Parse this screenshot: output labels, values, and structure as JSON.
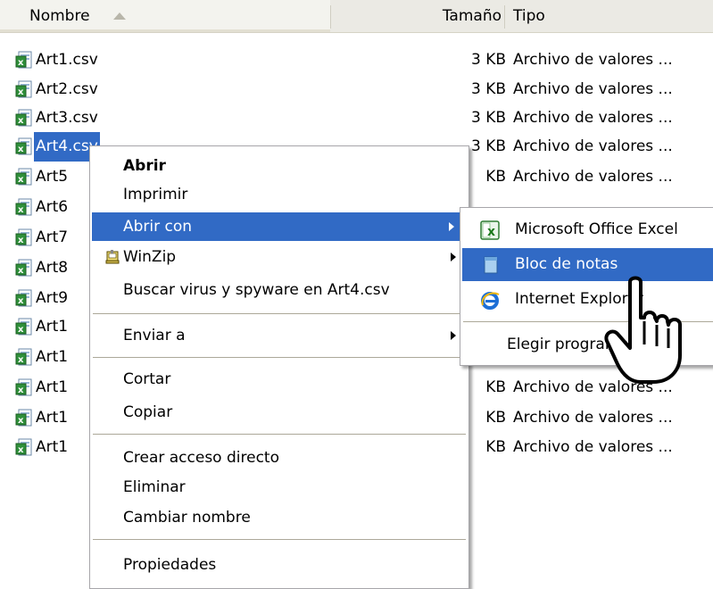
{
  "header": {
    "name": "Nombre",
    "size": "Tamaño",
    "type": "Tipo"
  },
  "files": [
    {
      "name": "Art1.csv",
      "size": "3 KB",
      "type": "Archivo de valores ..."
    },
    {
      "name": "Art2.csv",
      "size": "3 KB",
      "type": "Archivo de valores ..."
    },
    {
      "name": "Art3.csv",
      "size": "3 KB",
      "type": "Archivo de valores ..."
    },
    {
      "name": "Art4.csv",
      "size": "3 KB",
      "type": "Archivo de valores ..."
    },
    {
      "name": "Art5",
      "size": "KB",
      "type": "Archivo de valores ..."
    },
    {
      "name": "Art6",
      "size": "",
      "type": ""
    },
    {
      "name": "Art7",
      "size": "",
      "type": ""
    },
    {
      "name": "Art8",
      "size": "",
      "type": ""
    },
    {
      "name": "Art9",
      "size": "",
      "type": ""
    },
    {
      "name": "Art1",
      "size": "",
      "type": ""
    },
    {
      "name": "Art1",
      "size": "",
      "type": ""
    },
    {
      "name": "Art1",
      "size": "KB",
      "type": "Archivo de valores ..."
    },
    {
      "name": "Art1",
      "size": "KB",
      "type": "Archivo de valores ..."
    },
    {
      "name": "Art1",
      "size": "KB",
      "type": "Archivo de valores ..."
    }
  ],
  "context_menu": {
    "open": "Abrir",
    "print": "Imprimir",
    "open_with": "Abrir con",
    "winzip": "WinZip",
    "scan": "Buscar virus y spyware en Art4.csv",
    "send_to": "Enviar a",
    "cut": "Cortar",
    "copy": "Copiar",
    "create_shortcut": "Crear acceso directo",
    "delete": "Eliminar",
    "rename": "Cambiar nombre",
    "properties": "Propiedades"
  },
  "open_with_menu": {
    "excel": "Microsoft Office Excel",
    "notepad": "Bloc de notas",
    "ie": "Internet Explorer",
    "choose": "Elegir programa..."
  },
  "colors": {
    "selection": "#316ac5",
    "header_bg": "#ebeae4"
  }
}
